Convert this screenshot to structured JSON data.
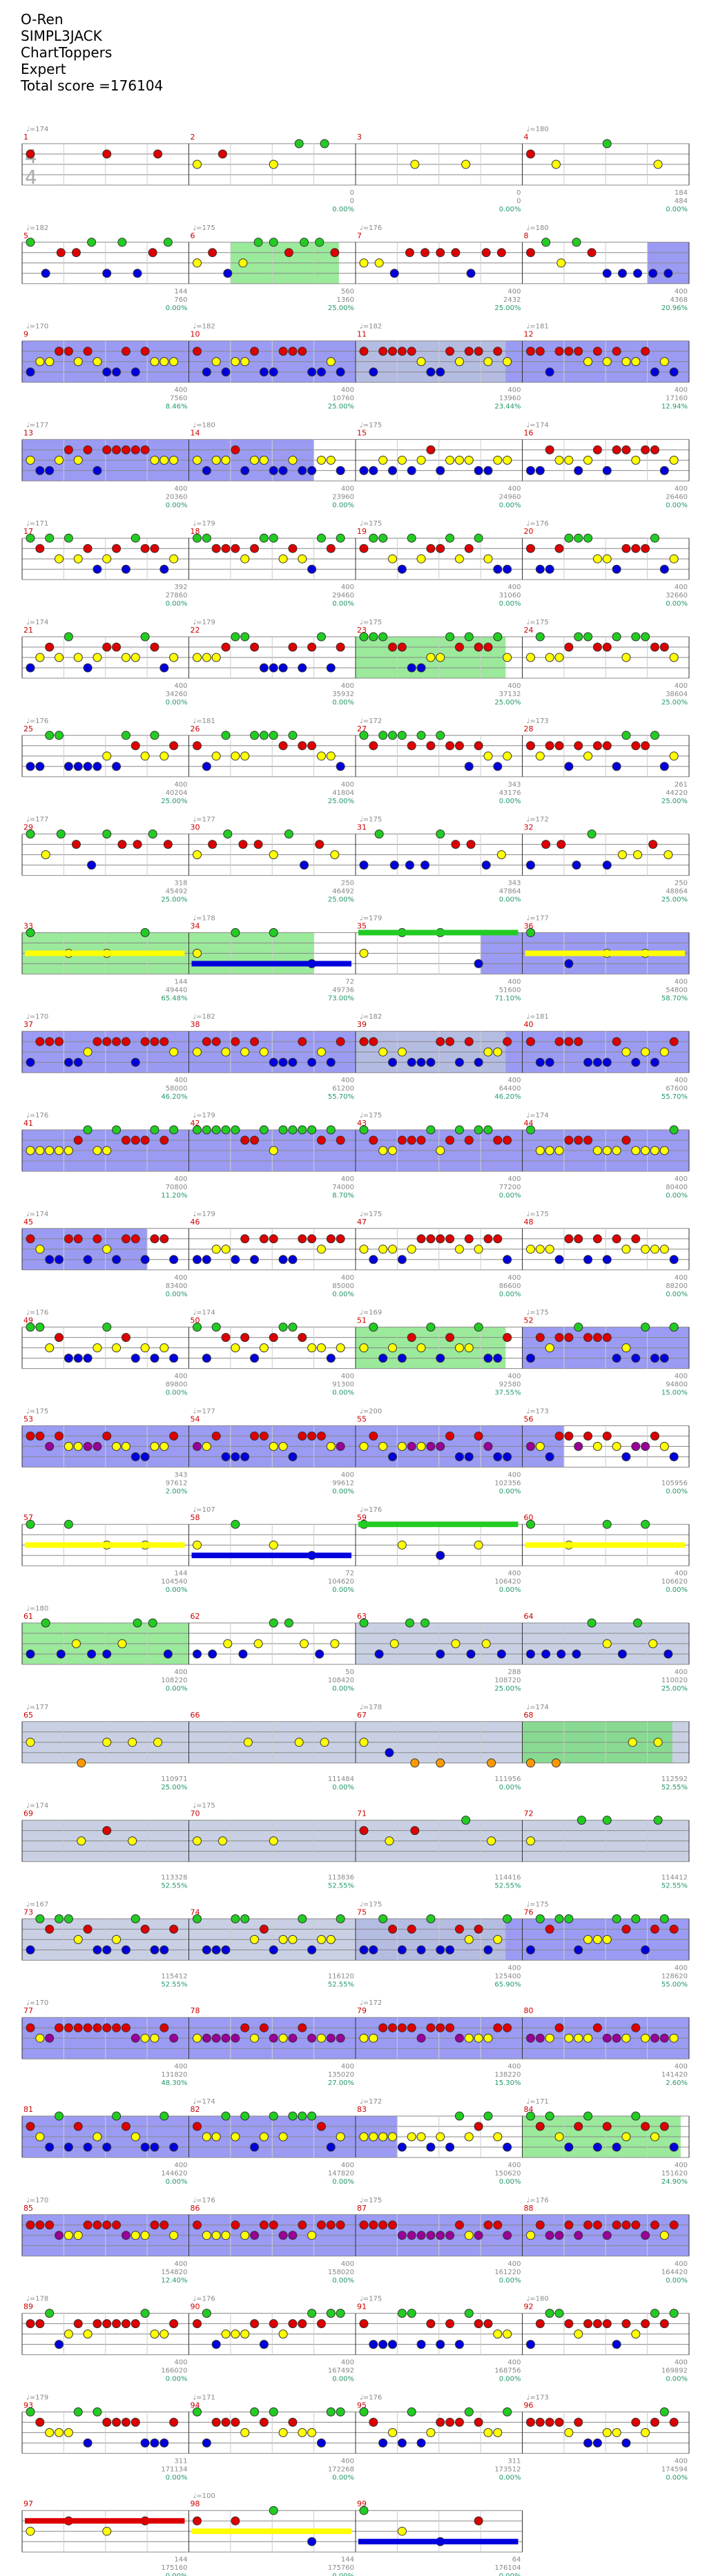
{
  "header": {
    "song": "O-Ren",
    "artist": "SIMPL3JACK",
    "charter": "ChartToppers",
    "difficulty": "Expert",
    "total_score_label": "Total score =",
    "total_score": "176104"
  },
  "colors": {
    "green": "#22cc22",
    "red": "#dd0000",
    "yellow": "#ffff00",
    "blue": "#0000dd",
    "orange": "#ff9900",
    "purple": "#990099",
    "sp_overdrive": "#6666ee",
    "sp_phrase": "#66dd66",
    "unison": "#bbc4dd",
    "squeeze": "#ff8888",
    "staff_line": "#888888",
    "bar_number": "#cc0000",
    "tempo": "#888888",
    "score": "#888888",
    "percent": "#229966"
  },
  "time_signature": "4/4",
  "rows": [
    {
      "label": "1",
      "measures": [
        "1",
        "2",
        "3",
        "4"
      ],
      "tempos": [
        "174",
        "",
        "",
        "180"
      ],
      "scores": [
        [
          "",
          "",
          ""
        ],
        [
          "0",
          "0",
          "0.00%"
        ],
        [
          "0",
          "0",
          "0.00%"
        ],
        [
          "184",
          "484",
          "0.00%"
        ]
      ],
      "sp": [],
      "notes": [
        "green",
        "yellow",
        "green",
        "red",
        "blue",
        "yellow"
      ],
      "pattern": "sparse"
    },
    {
      "label": "2",
      "measures": [
        "5",
        "6",
        "7",
        "8"
      ],
      "tempos": [
        "182",
        "175",
        "176",
        "180"
      ],
      "scores": [
        [
          "144",
          "760",
          "0.00%"
        ],
        [
          "560",
          "1360",
          "25.00%"
        ],
        [
          "400",
          "2432",
          "25.00%"
        ],
        [
          "400",
          "4368",
          "20.96%"
        ]
      ],
      "sp": [
        {
          "from": 1.25,
          "to": 1.9,
          "kind": "phrase"
        },
        {
          "from": 3.75,
          "to": 4,
          "kind": "overdrive"
        }
      ],
      "notes": [
        "green",
        "red",
        "yellow",
        "blue"
      ],
      "pattern": "mixed"
    },
    {
      "label": "3",
      "measures": [
        "9",
        "10",
        "11",
        "12"
      ],
      "tempos": [
        "170",
        "182",
        "182",
        "181"
      ],
      "scores": [
        [
          "400",
          "7560",
          "8.46%"
        ],
        [
          "400",
          "10760",
          "25.00%"
        ],
        [
          "400",
          "13960",
          "23.44%"
        ],
        [
          "400",
          "17160",
          "12.94%"
        ]
      ],
      "sp": [
        {
          "from": 0,
          "to": 4,
          "kind": "overdrive"
        },
        {
          "from": 2,
          "to": 2.9,
          "kind": "unison"
        }
      ],
      "notes": [
        "red",
        "yellow",
        "blue"
      ],
      "pattern": "dense"
    },
    {
      "label": "4",
      "measures": [
        "13",
        "14",
        "15",
        "16"
      ],
      "tempos": [
        "177",
        "180",
        "175",
        "174"
      ],
      "scores": [
        [
          "400",
          "20360",
          "0.00%"
        ],
        [
          "400",
          "23960",
          "0.00%"
        ],
        [
          "400",
          "24960",
          "0.00%"
        ],
        [
          "400",
          "26460",
          "0.00%"
        ]
      ],
      "sp": [
        {
          "from": 0,
          "to": 1.75,
          "kind": "overdrive"
        }
      ],
      "notes": [
        "red",
        "yellow",
        "blue"
      ],
      "pattern": "dense"
    },
    {
      "label": "5",
      "measures": [
        "17",
        "18",
        "19",
        "20"
      ],
      "tempos": [
        "171",
        "179",
        "175",
        "176"
      ],
      "scores": [
        [
          "392",
          "27860",
          "0.00%"
        ],
        [
          "400",
          "29460",
          "0.00%"
        ],
        [
          "400",
          "31060",
          "0.00%"
        ],
        [
          "400",
          "32660",
          "0.00%"
        ]
      ],
      "sp": [],
      "notes": [
        "green",
        "red",
        "yellow",
        "blue"
      ],
      "pattern": "dense"
    },
    {
      "label": "6",
      "measures": [
        "21",
        "22",
        "23",
        "24"
      ],
      "tempos": [
        "174",
        "179",
        "175",
        "175"
      ],
      "scores": [
        [
          "400",
          "34260",
          "0.00%"
        ],
        [
          "400",
          "35932",
          "0.00%"
        ],
        [
          "400",
          "37132",
          "25.00%"
        ],
        [
          "400",
          "38604",
          "25.00%"
        ]
      ],
      "sp": [
        {
          "from": 2,
          "to": 2.9,
          "kind": "phrase"
        }
      ],
      "notes": [
        "green",
        "red",
        "yellow",
        "blue"
      ],
      "pattern": "dense"
    },
    {
      "label": "7",
      "measures": [
        "25",
        "26",
        "27",
        "28"
      ],
      "tempos": [
        "176",
        "181",
        "172",
        "173"
      ],
      "scores": [
        [
          "400",
          "40204",
          "25.00%"
        ],
        [
          "400",
          "41804",
          "25.00%"
        ],
        [
          "343",
          "43176",
          "0.00%"
        ],
        [
          "261",
          "44220",
          "25.00%"
        ]
      ],
      "sp": [],
      "notes": [
        "green",
        "red",
        "yellow",
        "blue"
      ],
      "pattern": "dense"
    },
    {
      "label": "8",
      "measures": [
        "29",
        "30",
        "31",
        "32"
      ],
      "tempos": [
        "177",
        "177",
        "175",
        "172"
      ],
      "scores": [
        [
          "318",
          "45492",
          "25.00%"
        ],
        [
          "250",
          "46492",
          "25.00%"
        ],
        [
          "343",
          "47864",
          "0.00%"
        ],
        [
          "250",
          "48864",
          "25.00%"
        ]
      ],
      "sp": [],
      "notes": [
        "green",
        "red",
        "yellow",
        "blue"
      ],
      "pattern": "mixed"
    },
    {
      "label": "9",
      "measures": [
        "33",
        "34",
        "35",
        "36"
      ],
      "tempos": [
        "",
        "178",
        "179",
        "177"
      ],
      "scores": [
        [
          "144",
          "49440",
          "65.48%"
        ],
        [
          "72",
          "49736",
          "73.00%"
        ],
        [
          "400",
          "51600",
          "71.10%"
        ],
        [
          "400",
          "54800",
          "58.70%"
        ]
      ],
      "sp": [
        {
          "from": 0,
          "to": 1.75,
          "kind": "phrase"
        },
        {
          "from": 2.75,
          "to": 4,
          "kind": "overdrive"
        }
      ],
      "notes": [
        "green",
        "yellow",
        "blue"
      ],
      "pattern": "sustain"
    },
    {
      "label": "10",
      "measures": [
        "37",
        "38",
        "39",
        "40"
      ],
      "tempos": [
        "170",
        "182",
        "182",
        "181"
      ],
      "scores": [
        [
          "400",
          "58000",
          "46.20%"
        ],
        [
          "400",
          "61200",
          "55.70%"
        ],
        [
          "400",
          "64400",
          "46.20%"
        ],
        [
          "400",
          "67600",
          "55.70%"
        ]
      ],
      "sp": [
        {
          "from": 0,
          "to": 4,
          "kind": "overdrive"
        },
        {
          "from": 2,
          "to": 2.9,
          "kind": "unison"
        }
      ],
      "notes": [
        "red",
        "yellow",
        "blue"
      ],
      "pattern": "dense"
    },
    {
      "label": "11",
      "measures": [
        "41",
        "42",
        "43",
        "44"
      ],
      "tempos": [
        "176",
        "179",
        "175",
        "174"
      ],
      "scores": [
        [
          "400",
          "70800",
          "11.20%"
        ],
        [
          "400",
          "74000",
          "8.70%"
        ],
        [
          "400",
          "77200",
          "0.00%"
        ],
        [
          "400",
          "80400",
          "0.00%"
        ]
      ],
      "sp": [
        {
          "from": 0,
          "to": 4,
          "kind": "overdrive"
        }
      ],
      "notes": [
        "green",
        "red",
        "yellow"
      ],
      "pattern": "dense"
    },
    {
      "label": "12",
      "measures": [
        "45",
        "46",
        "47",
        "48"
      ],
      "tempos": [
        "174",
        "179",
        "175",
        "175"
      ],
      "scores": [
        [
          "400",
          "83400",
          "0.00%"
        ],
        [
          "400",
          "85000",
          "0.00%"
        ],
        [
          "400",
          "86600",
          "0.00%"
        ],
        [
          "400",
          "88200",
          "0.00%"
        ]
      ],
      "sp": [
        {
          "from": 0,
          "to": 0.75,
          "kind": "overdrive"
        }
      ],
      "notes": [
        "red",
        "yellow",
        "blue"
      ],
      "pattern": "dense"
    },
    {
      "label": "13",
      "measures": [
        "49",
        "50",
        "51",
        "52"
      ],
      "tempos": [
        "176",
        "174",
        "169",
        "175"
      ],
      "scores": [
        [
          "400",
          "89800",
          "0.00%"
        ],
        [
          "400",
          "91300",
          "0.00%"
        ],
        [
          "400",
          "92580",
          "37.55%"
        ],
        [
          "400",
          "94800",
          "15.00%"
        ]
      ],
      "sp": [
        {
          "from": 2,
          "to": 2.9,
          "kind": "phrase"
        },
        {
          "from": 3,
          "to": 4,
          "kind": "overdrive"
        }
      ],
      "notes": [
        "green",
        "red",
        "yellow",
        "blue"
      ],
      "pattern": "dense"
    },
    {
      "label": "14",
      "measures": [
        "53",
        "54",
        "55",
        "56"
      ],
      "tempos": [
        "175",
        "177",
        "200",
        "173"
      ],
      "scores": [
        [
          "343",
          "97612",
          "2.00%"
        ],
        [
          "400",
          "99612",
          "0.00%"
        ],
        [
          "400",
          "102356",
          "0.00%"
        ],
        [
          "",
          "105956",
          "0.00%"
        ]
      ],
      "sp": [
        {
          "from": 0,
          "to": 3.25,
          "kind": "overdrive"
        }
      ],
      "notes": [
        "red",
        "yellow",
        "blue",
        "purple"
      ],
      "pattern": "dense"
    },
    {
      "label": "15",
      "measures": [
        "57",
        "58",
        "59",
        "60"
      ],
      "tempos": [
        "",
        "107",
        "176",
        ""
      ],
      "scores": [
        [
          "144",
          "104540",
          "0.00%"
        ],
        [
          "72",
          "104620",
          "0.00%"
        ],
        [
          "400",
          "106420",
          "0.00%"
        ],
        [
          "400",
          "106620",
          "0.00%"
        ]
      ],
      "sp": [],
      "notes": [
        "green",
        "yellow",
        "blue"
      ],
      "pattern": "sustain"
    },
    {
      "label": "16",
      "measures": [
        "61",
        "62",
        "63",
        "64"
      ],
      "tempos": [
        "180",
        "",
        "",
        ""
      ],
      "scores": [
        [
          "400",
          "108220",
          "0.00%"
        ],
        [
          "50",
          "108420",
          "0.00%"
        ],
        [
          "288",
          "108720",
          "25.00%"
        ],
        [
          "400",
          "110020",
          "25.00%"
        ]
      ],
      "sp": [
        {
          "from": 0,
          "to": 1,
          "kind": "phrase"
        },
        {
          "from": 2,
          "to": 4,
          "kind": "unison"
        }
      ],
      "notes": [
        "green",
        "yellow",
        "blue"
      ],
      "pattern": "mixed"
    },
    {
      "label": "17",
      "measures": [
        "65",
        "66",
        "67",
        "68"
      ],
      "tempos": [
        "177",
        "",
        "178",
        "174"
      ],
      "scores": [
        [
          "",
          "110971",
          "25.00%"
        ],
        [
          "",
          "111484",
          "0.00%"
        ],
        [
          "",
          "111956",
          "0.00%"
        ],
        [
          "",
          "112592",
          "52.55%"
        ]
      ],
      "sp": [
        {
          "from": 0,
          "to": 4,
          "kind": "unison"
        },
        {
          "from": 3,
          "to": 3.9,
          "kind": "phrase"
        }
      ],
      "notes": [
        "yellow",
        "blue",
        "orange"
      ],
      "pattern": "sparse"
    },
    {
      "label": "18",
      "measures": [
        "69",
        "70",
        "71",
        "72"
      ],
      "tempos": [
        "174",
        "175",
        "",
        ""
      ],
      "scores": [
        [
          "",
          "113328",
          "52.55%"
        ],
        [
          "",
          "113836",
          "52.55%"
        ],
        [
          "",
          "114416",
          "52.55%"
        ],
        [
          "",
          "114412",
          "52.55%"
        ]
      ],
      "sp": [
        {
          "from": 0,
          "to": 4,
          "kind": "unison"
        }
      ],
      "notes": [
        "green",
        "red",
        "yellow"
      ],
      "pattern": "sparse"
    },
    {
      "label": "19",
      "measures": [
        "73",
        "74",
        "75",
        "76"
      ],
      "tempos": [
        "167",
        "",
        "175",
        "175"
      ],
      "scores": [
        [
          "",
          "115412",
          "52.55%"
        ],
        [
          "",
          "116120",
          "52.55%"
        ],
        [
          "400",
          "125400",
          "65.90%"
        ],
        [
          "400",
          "128620",
          "55.00%"
        ]
      ],
      "sp": [
        {
          "from": 0,
          "to": 2,
          "kind": "unison"
        },
        {
          "from": 2,
          "to": 4,
          "kind": "overdrive"
        },
        {
          "from": 2,
          "to": 2.9,
          "kind": "unison"
        }
      ],
      "notes": [
        "green",
        "red",
        "yellow",
        "blue"
      ],
      "pattern": "dense"
    },
    {
      "label": "20",
      "measures": [
        "77",
        "78",
        "79",
        "80"
      ],
      "tempos": [
        "170",
        "",
        "172",
        ""
      ],
      "scores": [
        [
          "400",
          "131820",
          "48.30%"
        ],
        [
          "400",
          "135020",
          "27.00%"
        ],
        [
          "400",
          "138220",
          "15.30%"
        ],
        [
          "400",
          "141420",
          "2.60%"
        ]
      ],
      "sp": [
        {
          "from": 0,
          "to": 4,
          "kind": "overdrive"
        }
      ],
      "notes": [
        "red",
        "yellow",
        "purple"
      ],
      "pattern": "dense"
    },
    {
      "label": "21",
      "measures": [
        "81",
        "82",
        "83",
        "84"
      ],
      "tempos": [
        "",
        "174",
        "172",
        "171"
      ],
      "scores": [
        [
          "400",
          "144620",
          "0.00%"
        ],
        [
          "400",
          "147820",
          "0.00%"
        ],
        [
          "400",
          "150620",
          "0.00%"
        ],
        [
          "400",
          "151620",
          "24.90%"
        ]
      ],
      "sp": [
        {
          "from": 0,
          "to": 2.25,
          "kind": "overdrive"
        },
        {
          "from": 3,
          "to": 3.95,
          "kind": "phrase"
        }
      ],
      "notes": [
        "green",
        "red",
        "yellow",
        "blue"
      ],
      "pattern": "dense"
    },
    {
      "label": "22",
      "measures": [
        "85",
        "86",
        "87",
        "88"
      ],
      "tempos": [
        "170",
        "176",
        "175",
        "176"
      ],
      "scores": [
        [
          "400",
          "154820",
          "12.40%"
        ],
        [
          "400",
          "158020",
          "0.00%"
        ],
        [
          "400",
          "161220",
          "0.00%"
        ],
        [
          "400",
          "164420",
          "0.00%"
        ]
      ],
      "sp": [
        {
          "from": 0,
          "to": 4,
          "kind": "overdrive"
        }
      ],
      "notes": [
        "red",
        "yellow",
        "purple"
      ],
      "pattern": "dense"
    },
    {
      "label": "23",
      "measures": [
        "89",
        "90",
        "91",
        "92"
      ],
      "tempos": [
        "178",
        "176",
        "175",
        "180"
      ],
      "scores": [
        [
          "400",
          "166020",
          "0.00%"
        ],
        [
          "400",
          "167492",
          "0.00%"
        ],
        [
          "400",
          "168756",
          "0.00%"
        ],
        [
          "400",
          "169892",
          "0.00%"
        ]
      ],
      "sp": [],
      "notes": [
        "green",
        "red",
        "yellow",
        "blue"
      ],
      "pattern": "dense"
    },
    {
      "label": "24",
      "measures": [
        "93",
        "94",
        "95",
        "96"
      ],
      "tempos": [
        "179",
        "171",
        "176",
        "173"
      ],
      "scores": [
        [
          "311",
          "171134",
          "0.00%"
        ],
        [
          "400",
          "172268",
          "0.00%"
        ],
        [
          "311",
          "173512",
          "0.00%"
        ],
        [
          "400",
          "174594",
          "0.00%"
        ]
      ],
      "sp": [],
      "notes": [
        "green",
        "red",
        "yellow",
        "blue"
      ],
      "pattern": "dense"
    },
    {
      "label": "25",
      "measures": [
        "97",
        "98",
        "99",
        ""
      ],
      "tempos": [
        "",
        "100",
        "",
        ""
      ],
      "scores": [
        [
          "144",
          "175160",
          "0.00%"
        ],
        [
          "144",
          "175760",
          "0.00%"
        ],
        [
          "64",
          "176104",
          "0.00%"
        ],
        [
          "",
          "",
          ""
        ]
      ],
      "sp": [],
      "notes": [
        "green",
        "red",
        "yellow",
        "blue"
      ],
      "pattern": "ending"
    }
  ]
}
